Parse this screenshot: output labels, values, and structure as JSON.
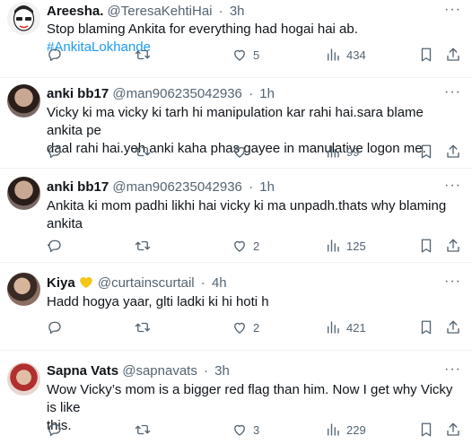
{
  "tweets": [
    {
      "name": "Areesha.",
      "handle": "@TeresaKehtiHai",
      "sep": "·",
      "time": "3h",
      "text": "Stop blaming Ankita for everything had hogai hai ab. ",
      "hashtag": "#AnkitaLokhande",
      "text_2": "",
      "replies": "",
      "retweets": "",
      "likes": "5",
      "views": "434"
    },
    {
      "name": "anki bb17",
      "handle": "@man906235042936",
      "sep": "·",
      "time": "1h",
      "text": "Vicky ki ma vicky ki tarh hi manipulation kar rahi hai.sara blame ankita pe",
      "text_2": "daal rahi hai.yeh anki kaha phas gayee in manulative logon me.",
      "replies": "",
      "retweets": "",
      "likes": "",
      "views": "99"
    },
    {
      "name": "anki bb17",
      "handle": "@man906235042936",
      "sep": "·",
      "time": "1h",
      "text": "Ankita ki mom padhi likhi hai vicky ki ma unpadh.thats why blaming ankita",
      "text_2": ".",
      "replies": "",
      "retweets": "",
      "likes": "2",
      "views": "125"
    },
    {
      "name": "Kiya",
      "handle": "@curtainscurtail",
      "sep": "·",
      "time": "4h",
      "text": "Hadd hogya yaar, glti ladki ki hi hoti h",
      "text_2": "",
      "replies": "",
      "retweets": "",
      "likes": "2",
      "views": "421"
    },
    {
      "name": "Sapna Vats",
      "handle": "@sapnavats",
      "sep": "·",
      "time": "3h",
      "text": "Wow Vicky’s mom is a bigger red flag than him. Now I get why Vicky is like",
      "text_2": "this.",
      "replies": "",
      "retweets": "",
      "likes": "3",
      "views": "229"
    }
  ],
  "more_glyph": "···",
  "colors": {
    "accent": "#1d9bf0",
    "secondary": "#536471",
    "text": "#0f1419",
    "divider": "#eff3f4",
    "badge": "#f5c518"
  },
  "icons": [
    "reply-icon",
    "retweet-icon",
    "like-icon",
    "views-icon",
    "bookmark-icon",
    "share-icon",
    "more-icon",
    "heart-badge-icon"
  ]
}
